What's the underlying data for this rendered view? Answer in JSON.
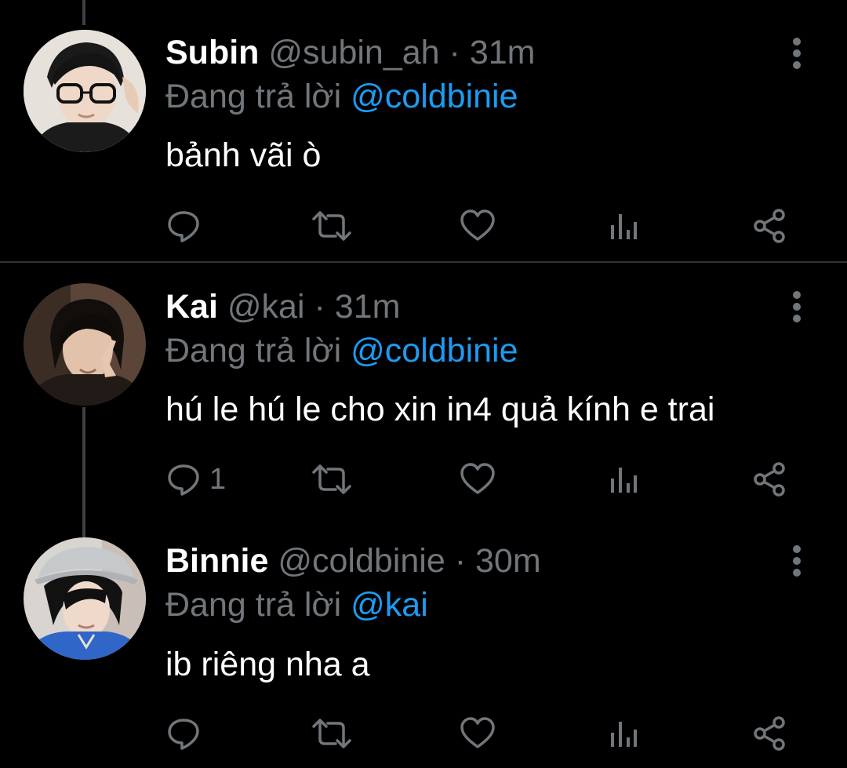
{
  "tweets": [
    {
      "name": "Subin",
      "handle": "@subin_ah",
      "dot": "·",
      "time": "31m",
      "reply_prefix": "Đang trả lời",
      "reply_to": "@coldbinie",
      "text": "bảnh vãi ò",
      "reply_count": "",
      "avatar_icon": "avatar-photo"
    },
    {
      "name": "Kai",
      "handle": "@kai",
      "dot": "·",
      "time": "31m",
      "reply_prefix": "Đang trả lời",
      "reply_to": "@coldbinie",
      "text": "hú le hú le cho xin in4 quả kính e trai",
      "reply_count": "1",
      "avatar_icon": "avatar-photo"
    },
    {
      "name": "Binnie",
      "handle": "@coldbinie",
      "dot": "·",
      "time": "30m",
      "reply_prefix": "Đang trả lời",
      "reply_to": "@kai",
      "text": "ib riêng nha a",
      "reply_count": "",
      "avatar_icon": "avatar-photo"
    }
  ],
  "icons": {
    "reply": "reply-icon",
    "retweet": "retweet-icon",
    "like": "like-icon",
    "views": "views-icon",
    "share": "share-icon",
    "more": "more-icon"
  },
  "colors": {
    "background": "#000000",
    "text": "#ffffff",
    "secondary": "#71767b",
    "accent": "#1d9bf0",
    "divider": "#2f3336"
  }
}
